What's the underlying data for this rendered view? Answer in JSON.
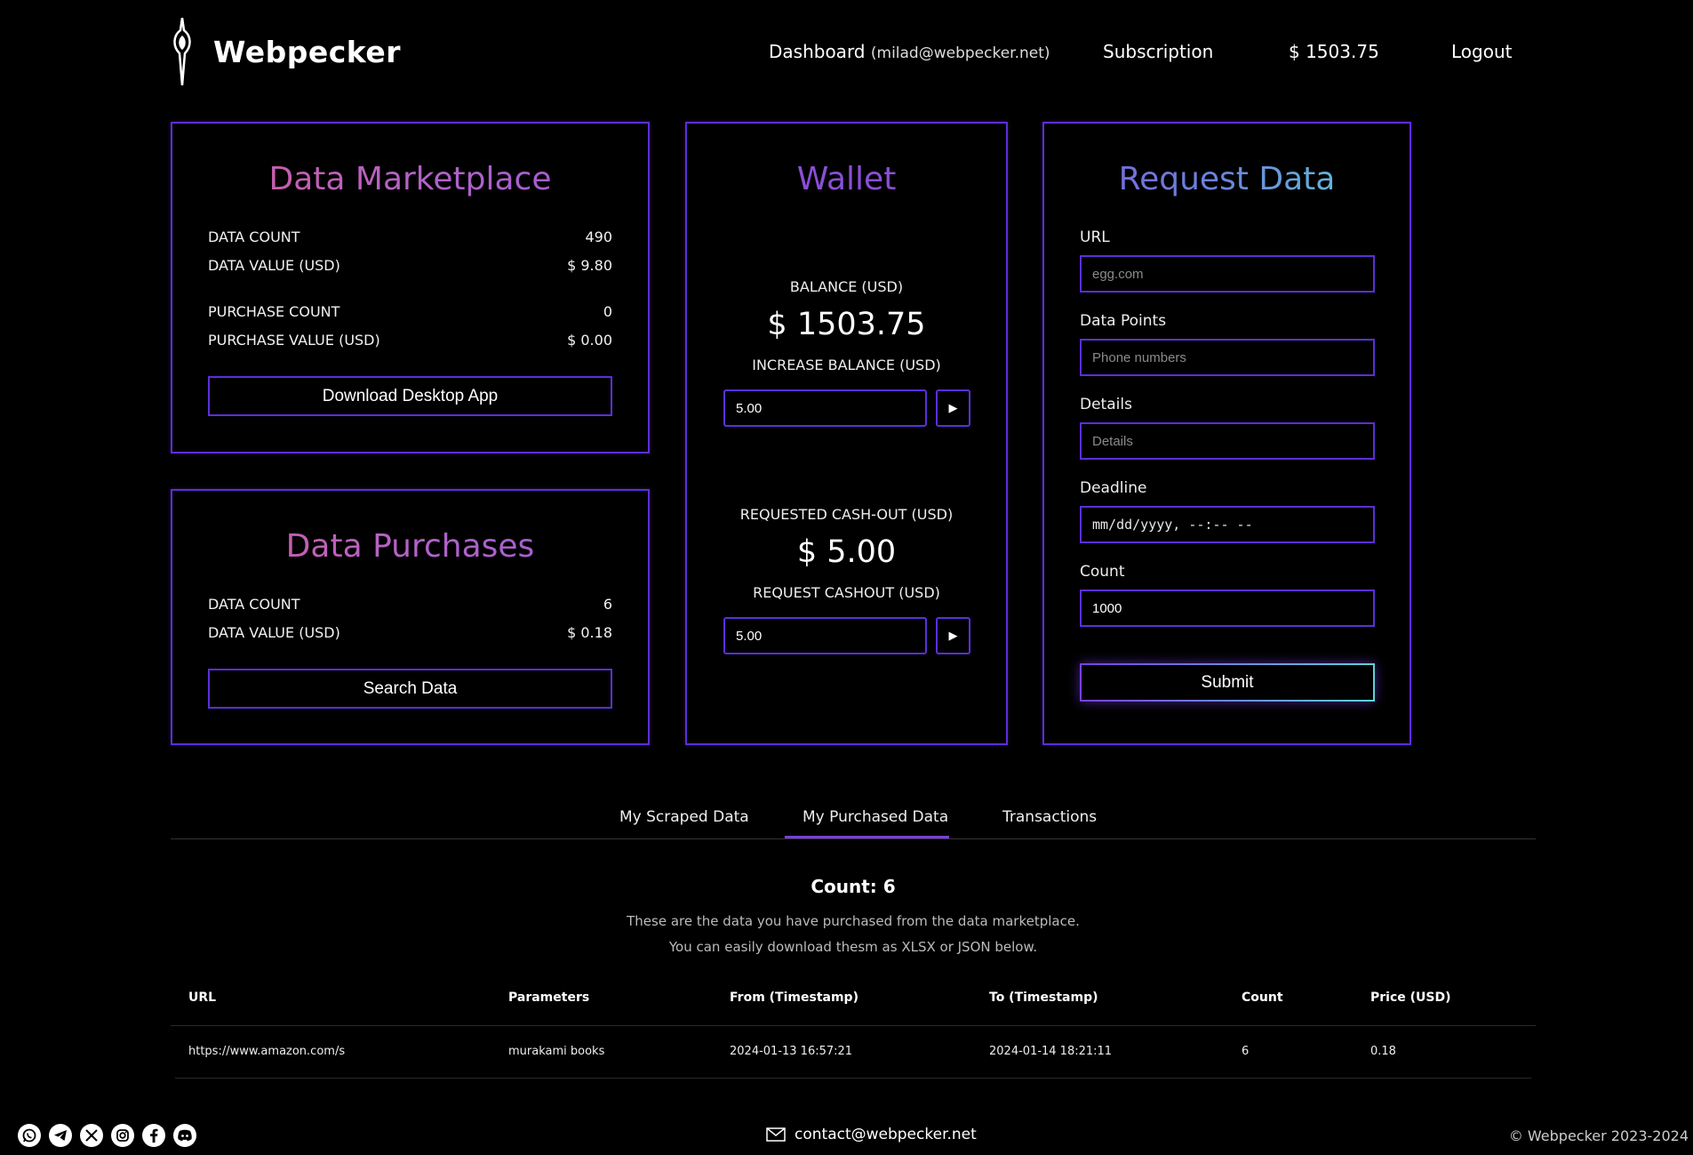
{
  "header": {
    "brand": "Webpecker",
    "nav": {
      "dashboard": "Dashboard",
      "email": "(milad@webpecker.net)",
      "subscription": "Subscription",
      "balance": "$ 1503.75",
      "logout": "Logout"
    }
  },
  "marketplace": {
    "title": "Data Marketplace",
    "data_count_label": "DATA COUNT",
    "data_count": "490",
    "data_value_label": "DATA VALUE (USD)",
    "data_value": "$ 9.80",
    "purchase_count_label": "PURCHASE COUNT",
    "purchase_count": "0",
    "purchase_value_label": "PURCHASE VALUE (USD)",
    "purchase_value": "$ 0.00",
    "button": "Download Desktop App"
  },
  "purchases": {
    "title": "Data Purchases",
    "data_count_label": "DATA COUNT",
    "data_count": "6",
    "data_value_label": "DATA VALUE (USD)",
    "data_value": "$ 0.18",
    "button": "Search Data"
  },
  "wallet": {
    "title": "Wallet",
    "balance_label": "BALANCE (USD)",
    "balance": "$ 1503.75",
    "increase_label": "INCREASE BALANCE (USD)",
    "increase_value": "5.00",
    "cashout_requested_label": "REQUESTED CASH-OUT (USD)",
    "cashout_requested": "$ 5.00",
    "cashout_label": "REQUEST CASHOUT (USD)",
    "cashout_value": "5.00",
    "play_glyph": "▶"
  },
  "request": {
    "title": "Request Data",
    "url_label": "URL",
    "url_placeholder": "egg.com",
    "points_label": "Data Points",
    "points_placeholder": "Phone numbers",
    "details_label": "Details",
    "details_placeholder": "Details",
    "deadline_label": "Deadline",
    "deadline_placeholder": "mm/dd/yyyy, --:-- --",
    "count_label": "Count",
    "count_value": "1000",
    "submit": "Submit"
  },
  "tabs": [
    "My Scraped Data",
    "My Purchased Data",
    "Transactions"
  ],
  "active_tab": "My Purchased Data",
  "table_section": {
    "count_title": "Count: 6",
    "desc_1": "These are the data you have purchased from the data marketplace.",
    "desc_2": "You can easily download thesm as XLSX or JSON below.",
    "columns": [
      "URL",
      "Parameters",
      "From (Timestamp)",
      "To (Timestamp)",
      "Count",
      "Price (USD)"
    ],
    "rows": [
      [
        "https://www.amazon.com/s",
        "murakami books",
        "2024-01-13 16:57:21",
        "2024-01-14 18:21:11",
        "6",
        "0.18"
      ]
    ]
  },
  "footer": {
    "socials": [
      "whatsapp-icon",
      "telegram-icon",
      "x-icon",
      "instagram-icon",
      "facebook-icon",
      "discord-icon"
    ],
    "email": "contact@webpecker.net",
    "copyright": "© Webpecker 2023-2024"
  },
  "colors": {
    "accent": "#5b2fd8",
    "background": "#000000"
  }
}
